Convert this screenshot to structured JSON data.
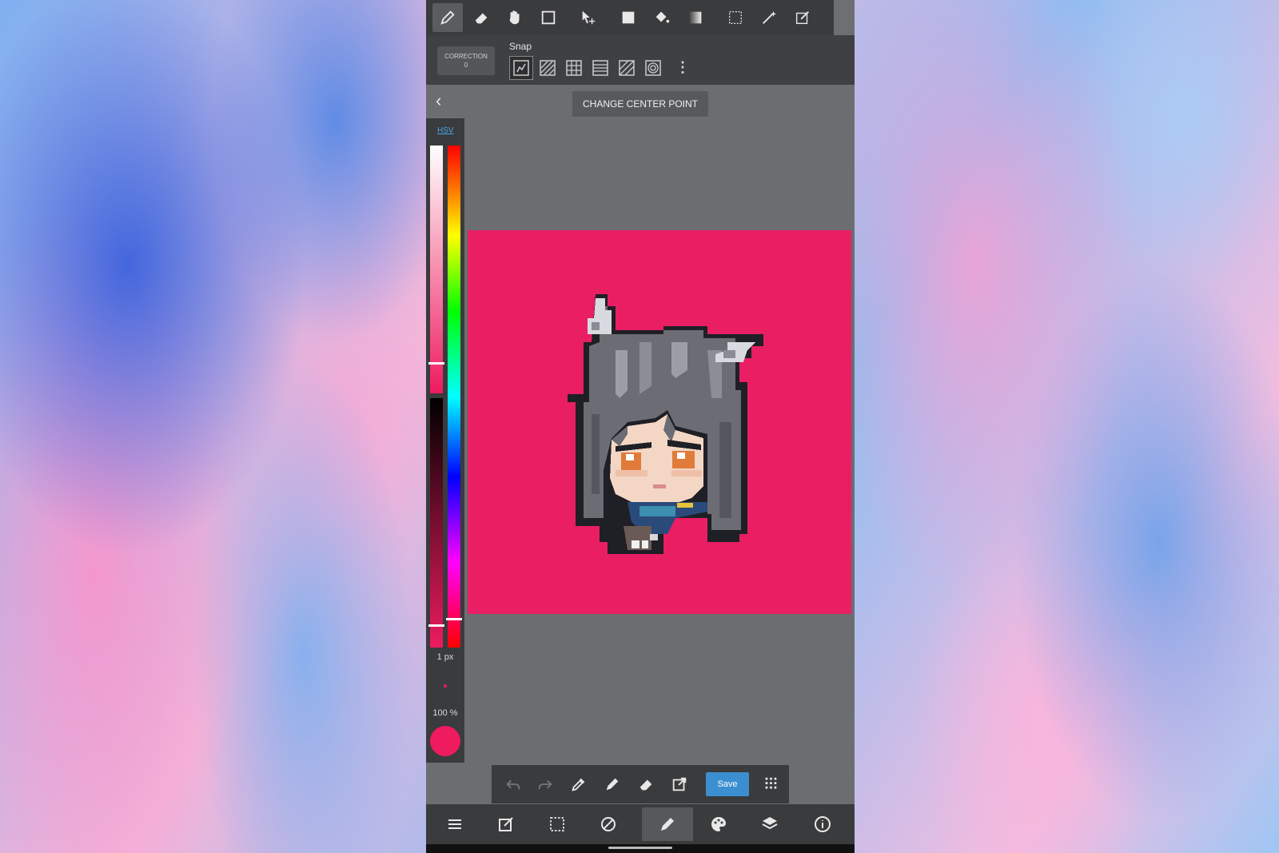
{
  "app": {
    "toolbar": {
      "tools": [
        {
          "icon": "pencil-icon",
          "active": true
        },
        {
          "icon": "eraser-icon",
          "active": false
        },
        {
          "icon": "hand-icon",
          "active": false
        },
        {
          "icon": "shape-rect-icon",
          "active": false
        },
        {
          "icon": "move-select-icon",
          "active": false
        },
        {
          "icon": "fill-rect-icon",
          "active": false
        },
        {
          "icon": "bucket-icon",
          "active": false
        },
        {
          "icon": "gradient-icon",
          "active": false
        },
        {
          "icon": "select-rect-icon",
          "active": false
        },
        {
          "icon": "magic-wand-icon",
          "active": false
        },
        {
          "icon": "select-pen-icon",
          "active": false
        }
      ]
    },
    "snap": {
      "correction_label": "CORRECTION",
      "correction_value": "0",
      "label": "Snap",
      "options": [
        "snap-off-icon",
        "snap-parallel-icon",
        "snap-grid-icon",
        "snap-perspective-icon",
        "snap-diagonal-icon",
        "snap-circle-icon"
      ],
      "more_icon": "more-vert-icon"
    },
    "tooltip": "CHANGE CENTER POINT",
    "color_panel": {
      "mode": "HSV",
      "brush_size": "1 px",
      "opacity": "100 %",
      "current_color": "#ee1b5f"
    },
    "canvas": {
      "background_color": "#e91e63",
      "subject": "pixel-art character"
    },
    "quickbar": {
      "save_label": "Save",
      "icons": [
        "undo-icon",
        "redo-icon",
        "eyedropper-icon",
        "pencil-icon",
        "eraser-icon",
        "transform-icon",
        "grid-icon"
      ]
    },
    "bottom_nav": {
      "icons": [
        "menu-icon",
        "edit-icon",
        "selection-icon",
        "rotate-icon",
        "brush-icon",
        "palette-icon",
        "layers-icon",
        "info-icon"
      ],
      "active": "brush-icon"
    }
  }
}
